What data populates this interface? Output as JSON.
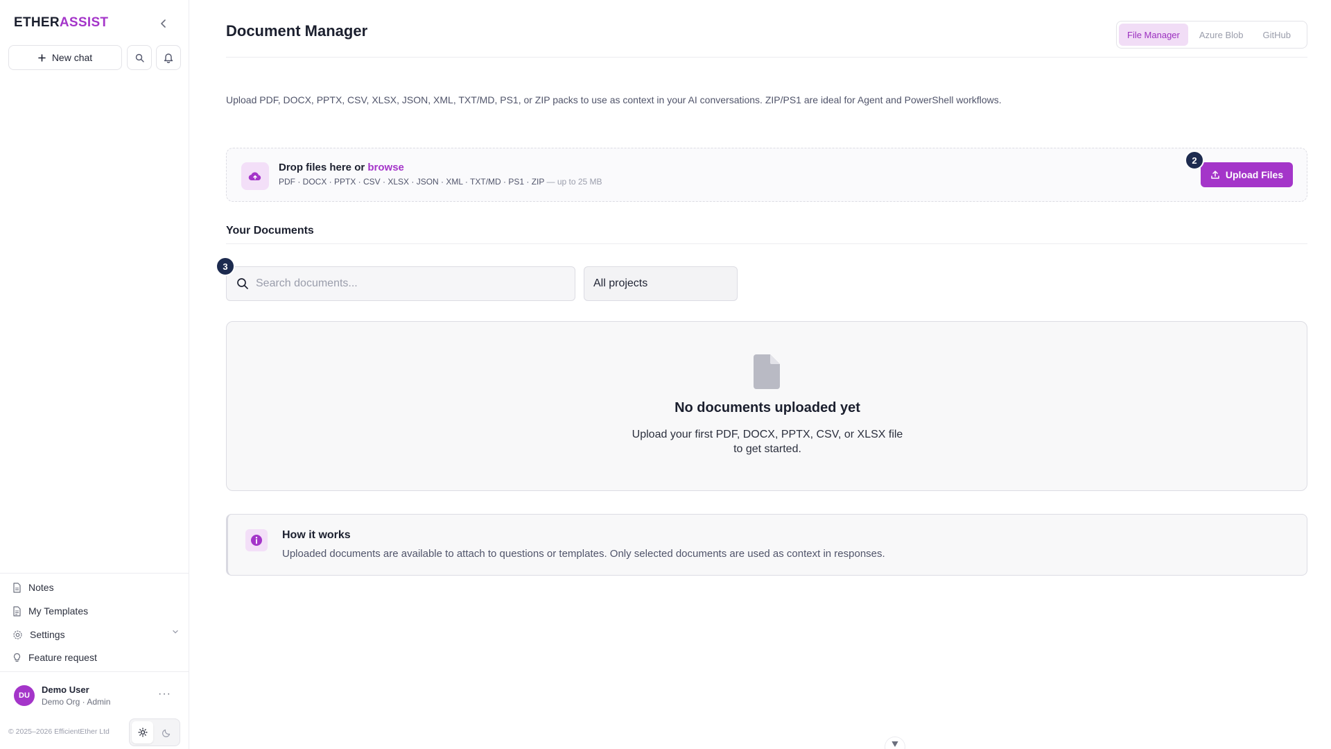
{
  "brand": {
    "part1": "ETHER",
    "part2": "ASSIST"
  },
  "sidebar": {
    "new_chat_label": "New chat",
    "nav": [
      {
        "label": "Notes"
      },
      {
        "label": "My Templates"
      },
      {
        "label": "Settings"
      },
      {
        "label": "Feature request"
      }
    ],
    "user": {
      "initials": "DU",
      "name": "Demo User",
      "role": "Demo Org · Admin",
      "more": "···"
    },
    "copyright": "© 2025–2026 EfficientEther Ltd"
  },
  "header": {
    "title": "Document Manager",
    "tabs": [
      {
        "label": "File Manager",
        "active": true
      },
      {
        "label": "Azure Blob",
        "active": false
      },
      {
        "label": "GitHub",
        "active": false
      }
    ]
  },
  "intro": "Upload PDF, DOCX, PPTX, CSV, XLSX, JSON, XML, TXT/MD, PS1, or ZIP packs to use as context in your AI conversations. ZIP/PS1 are ideal for Agent and PowerShell workflows.",
  "dropzone": {
    "title_prefix": "Drop files here or",
    "browse": "browse",
    "formats": "PDF · DOCX · PPTX · CSV · XLSX · JSON · XML · TXT/MD · PS1 · ZIP",
    "limit": "— up to 25 MB",
    "upload_label": "Upload Files",
    "badge": "2"
  },
  "documents": {
    "title": "Your Documents",
    "search_placeholder": "Search documents...",
    "search_badge": "3",
    "project_filter": "All projects",
    "empty_title": "No documents uploaded yet",
    "empty_text": "Upload your first PDF, DOCX, PPTX, CSV, or XLSX file to get started."
  },
  "how": {
    "title": "How it works",
    "text": "Uploaded documents are available to attach to questions or templates. Only selected documents are used as context in responses."
  },
  "colors": {
    "accent": "#a435c9",
    "badge": "#1d2b4f"
  }
}
